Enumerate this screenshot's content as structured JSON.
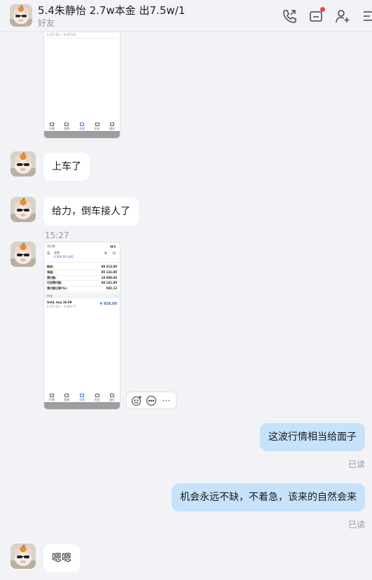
{
  "header": {
    "title": "5.4朱静怡 2.7w本金 出7.5w/1",
    "subtitle": "好友"
  },
  "screenshot_top": {
    "price_change": "4 477.03 → 4 477.82",
    "nav": [
      "行情",
      "图表",
      "交易",
      "历史",
      "报价"
    ]
  },
  "messages": [
    {
      "text": "上车了"
    },
    {
      "text": "给力，倒车接人了"
    }
  ],
  "timestamp": "15:27",
  "screenshot_mid": {
    "status_time": "15:26",
    "header_label": "交易",
    "balance_value": "4 928.00 USD",
    "account_rows": [
      {
        "label": "结余:",
        "value": "88 313.00"
      },
      {
        "label": "净值:",
        "value": "85 141.80"
      },
      {
        "label": "预付款:",
        "value": "18 000.00"
      },
      {
        "label": "可用预付款:",
        "value": "69 141.80"
      },
      {
        "label": "预付款比率(%):",
        "value": "502.13"
      }
    ],
    "positions_label": "持仓",
    "position": {
      "symbol": "Gold, buy 16.00",
      "price_change": "4 477.03 → 4 480.71",
      "profit": "4 928.00"
    },
    "nav": [
      "行情",
      "图表",
      "交易",
      "历史",
      "报价"
    ]
  },
  "toolbar": {
    "more_label": "···"
  },
  "outgoing": [
    {
      "text": "这波行情相当给面子",
      "status": "已读"
    },
    {
      "text": "机会永远不缺，不着急，该来的自然会来",
      "status": "已读"
    }
  ],
  "last_message": {
    "text": "嗯嗯"
  },
  "colors": {
    "background": "#f2f3f7",
    "outgoing_bubble": "#c7e2fb",
    "incoming_bubble": "#ffffff",
    "profit_blue": "#2f6fd6",
    "notification_red": "#f04040"
  }
}
